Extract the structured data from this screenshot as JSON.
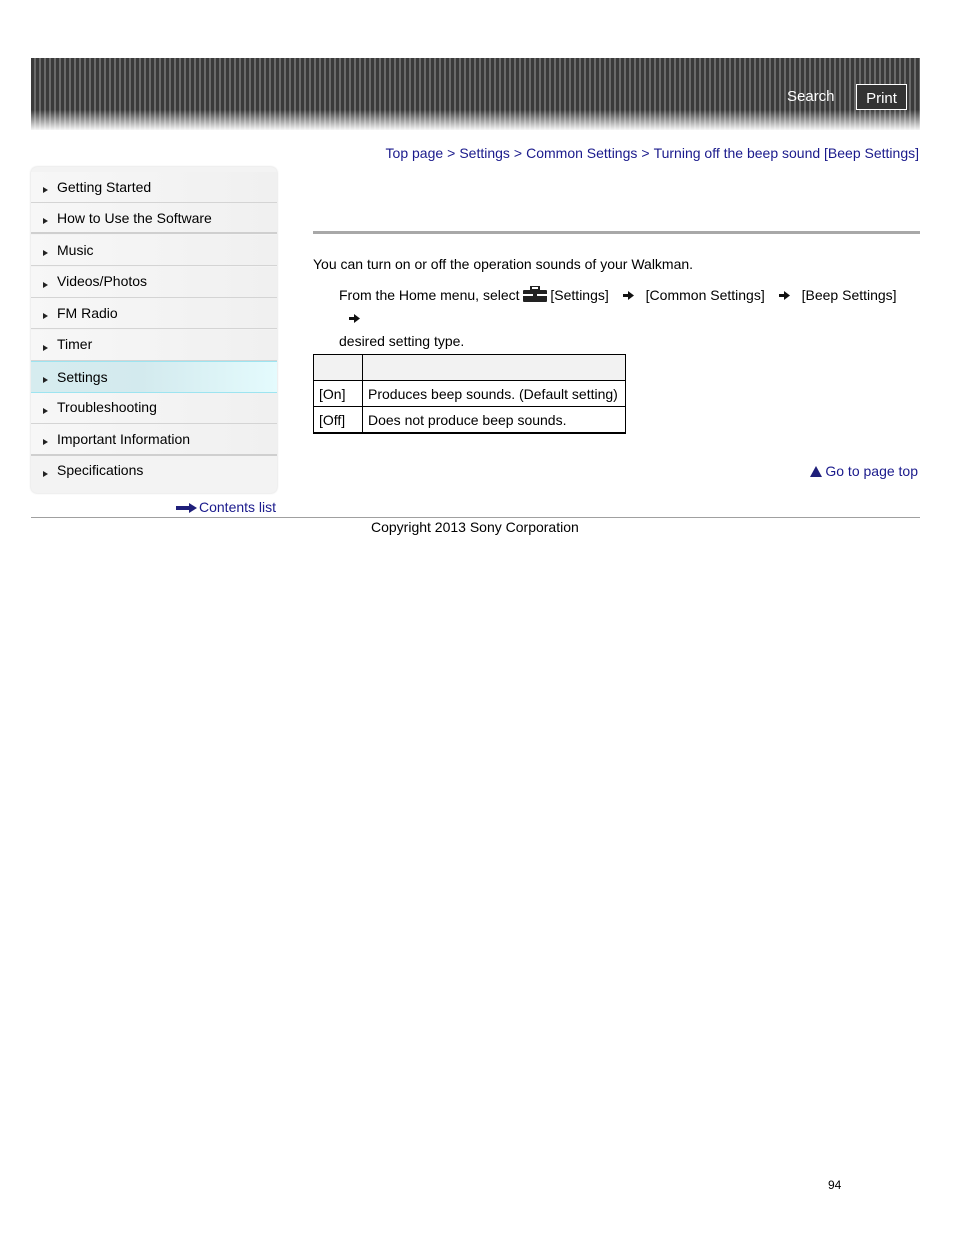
{
  "header": {
    "search_label": "Search",
    "print_label": "Print"
  },
  "breadcrumb": [
    {
      "label": "Top page"
    },
    {
      "label": "Settings"
    },
    {
      "label": "Common Settings"
    },
    {
      "label": "Turning off the beep sound [Beep Settings]"
    }
  ],
  "breadcrumb_separator": ">",
  "sidebar": {
    "items": [
      {
        "label": "Getting Started"
      },
      {
        "label": "How to Use the Software"
      },
      {
        "label": "Music"
      },
      {
        "label": "Videos/Photos"
      },
      {
        "label": "FM Radio"
      },
      {
        "label": "Timer"
      },
      {
        "label": "Settings",
        "active": true
      },
      {
        "label": "Troubleshooting"
      },
      {
        "label": "Important Information"
      },
      {
        "label": "Specifications"
      }
    ],
    "contents_list_label": "Contents list"
  },
  "main": {
    "intro": "You can turn on or off the operation sounds of your Walkman.",
    "step": {
      "prefix": "From the Home menu, select",
      "icon": "toolbox-icon",
      "parts": [
        "[Settings]",
        "[Common Settings]",
        "[Beep Settings]"
      ],
      "suffix": "desired setting type."
    },
    "table": {
      "headers": [
        "",
        ""
      ],
      "rows": [
        [
          "[On]",
          "Produces beep sounds. (Default setting)"
        ],
        [
          "[Off]",
          "Does not produce beep sounds."
        ]
      ]
    },
    "go_to_top_label": "Go to page top"
  },
  "footer": {
    "copyright": "Copyright 2013 Sony Corporation",
    "page_number": "94"
  },
  "colors": {
    "link": "#1a1a8c",
    "active_item": "#d6ecef"
  }
}
